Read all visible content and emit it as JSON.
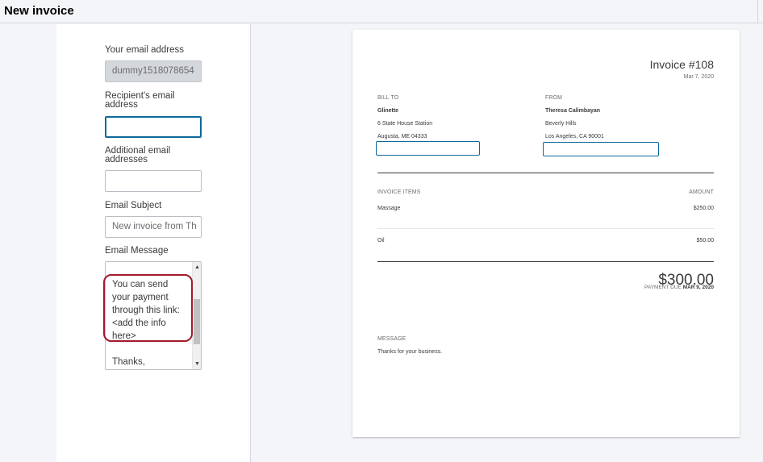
{
  "header": {
    "title": "New invoice"
  },
  "form": {
    "your_email_label": "Your email address",
    "your_email_value": "dummy1518078654",
    "recipient_label": "Recipient's email address",
    "recipient_value": "",
    "additional_label": "Additional email addresses",
    "additional_value": "",
    "subject_label": "Email Subject",
    "subject_value": "New invoice from Th",
    "message_label": "Email Message",
    "message_value": "You can send\nyour payment\nthrough this link:\n<add the info\nhere>\n\nThanks,"
  },
  "invoice": {
    "title": "Invoice #108",
    "date": "Mar 7, 2020",
    "bill_to_label": "BILL TO",
    "bill_to_name": "Glinette",
    "bill_to_line1": "6 State House Station",
    "bill_to_line2": "Augusta, ME 04333",
    "from_label": "FROM",
    "from_name": "Theresa Calimbayan",
    "from_line1": "Beverly Hills",
    "from_line2": "Los Angeles, CA 90001",
    "items_label": "INVOICE ITEMS",
    "amount_label": "AMOUNT",
    "items": [
      {
        "name": "Massage",
        "amount": "$250.00"
      },
      {
        "name": "Oil",
        "amount": "$50.00"
      }
    ],
    "total": "$300.00",
    "payment_due_label": "PAYMENT DUE",
    "payment_due_date": "MAR 9, 2020",
    "message_label": "MESSAGE",
    "message_text": "Thanks for your business."
  },
  "colors": {
    "focus": "#0d6a9c",
    "highlight": "#a3192c"
  }
}
